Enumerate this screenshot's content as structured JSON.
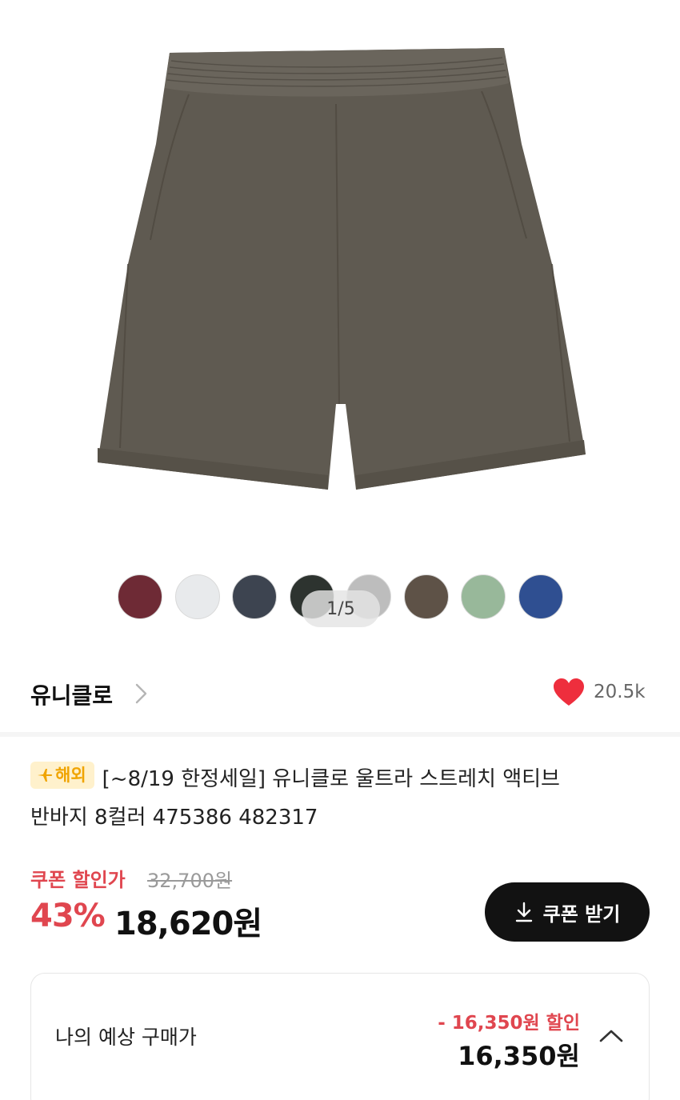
{
  "product_image": {
    "icon": "shorts-image",
    "color": "#5f5a51"
  },
  "swatches": [
    {
      "color": "#6e2a35"
    },
    {
      "color": "#e8eaec"
    },
    {
      "color": "#3d4450"
    },
    {
      "color": "#2d332f"
    },
    {
      "color": "#bdbdbd"
    },
    {
      "color": "#5e5247"
    },
    {
      "color": "#98b89a"
    },
    {
      "color": "#2f4f91"
    }
  ],
  "gallery": {
    "page_indicator": "1/5"
  },
  "brand": {
    "name": "유니클로",
    "chevron_icon": "chevron-right-icon",
    "like_icon": "heart-icon",
    "like_color": "#ee2e3d",
    "like_count": "20.5k"
  },
  "product": {
    "badge": "해외",
    "badge_icon": "airplane-icon",
    "title_line1": "[~8/19 한정세일] 유니클로 울트라 스트레치 액티브",
    "title_line2": "반바지 8컬러 475386 482317"
  },
  "price": {
    "coupon_label": "쿠폰 할인가",
    "original": "32,700원",
    "discount_rate": "43%",
    "sale": "18,620원",
    "accent_color": "#e0464f"
  },
  "coupon_button": {
    "label": "쿠폰 받기",
    "icon": "download-icon"
  },
  "estimate": {
    "label": "나의 예상 구매가",
    "discount": "- 16,350원 할인",
    "price": "16,350원",
    "toggle_icon": "chevron-up-icon"
  }
}
